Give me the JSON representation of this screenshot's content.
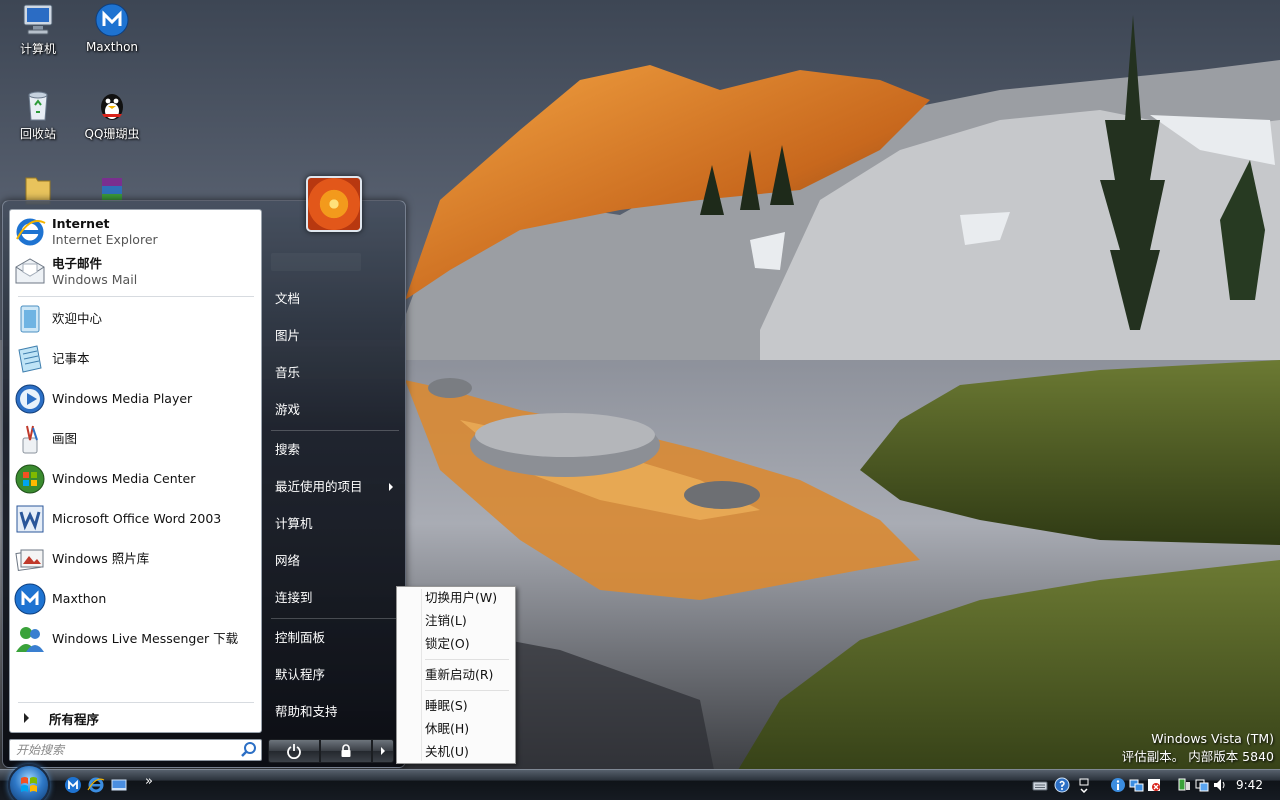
{
  "desktop": {
    "icons": [
      {
        "label": "计算机"
      },
      {
        "label": "Maxthon"
      },
      {
        "label": "回收站"
      },
      {
        "label": "QQ珊瑚虫"
      },
      {
        "label": ""
      },
      {
        "label": ""
      }
    ],
    "watermark": {
      "line1": "Windows Vista (TM)",
      "line2": "评估副本。 内部版本 5840"
    }
  },
  "start_menu": {
    "pinned": [
      {
        "title": "Internet",
        "subtitle": "Internet Explorer"
      },
      {
        "title": "电子邮件",
        "subtitle": "Windows Mail"
      }
    ],
    "recent": [
      {
        "label": "欢迎中心"
      },
      {
        "label": "记事本"
      },
      {
        "label": "Windows Media Player"
      },
      {
        "label": "画图"
      },
      {
        "label": "Windows Media Center"
      },
      {
        "label": "Microsoft Office Word 2003"
      },
      {
        "label": "Windows 照片库"
      },
      {
        "label": "Maxthon"
      },
      {
        "label": "Windows Live Messenger 下载"
      }
    ],
    "all_programs": "所有程序",
    "search_placeholder": "开始搜索",
    "right_items": [
      {
        "label": "文档"
      },
      {
        "label": "图片"
      },
      {
        "label": "音乐"
      },
      {
        "label": "游戏"
      },
      {
        "label": "搜索"
      },
      {
        "label": "最近使用的项目"
      },
      {
        "label": "计算机"
      },
      {
        "label": "网络"
      },
      {
        "label": "连接到"
      },
      {
        "label": "控制面板"
      },
      {
        "label": "默认程序"
      },
      {
        "label": "帮助和支持"
      }
    ]
  },
  "power_submenu": {
    "items": [
      {
        "label": "切换用户(W)"
      },
      {
        "label": "注销(L)"
      },
      {
        "label": "锁定(O)"
      },
      {
        "label": "重新启动(R)"
      },
      {
        "label": "睡眠(S)"
      },
      {
        "label": "休眠(H)"
      },
      {
        "label": "关机(U)"
      }
    ]
  },
  "taskbar": {
    "overflow": "»",
    "clock": "9:42"
  },
  "colors": {
    "accent": "#2e78c7",
    "menu_dark": "#1a1f27"
  }
}
